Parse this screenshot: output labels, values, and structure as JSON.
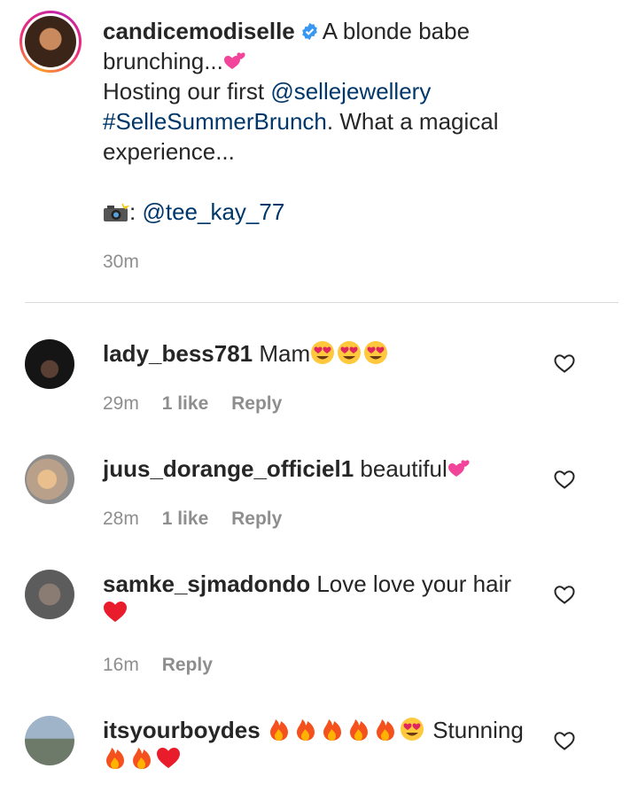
{
  "caption": {
    "username": "candicemodiselle",
    "line1": "A blonde babe",
    "line2": "brunching...",
    "hosting_prefix": "Hosting our first",
    "mention": "@sellejewellery",
    "hashtag": "#SelleSummerBrunch",
    "after_hashtag": ". What a magical",
    "line5": "experience...",
    "photo_credit_sep": ":",
    "photo_credit": "@tee_kay_77",
    "time": "30m"
  },
  "comments": [
    {
      "username": "lady_bess781",
      "text": "Mam",
      "emojis": [
        "heart-eyes-emoji",
        "heart-eyes-emoji",
        "heart-eyes-emoji"
      ],
      "time": "29m",
      "likes": "1 like",
      "reply": "Reply"
    },
    {
      "username": "juus_dorange_officiel1",
      "text": "beautiful",
      "emojis": [
        "two-hearts-emoji"
      ],
      "time": "28m",
      "likes": "1 like",
      "reply": "Reply"
    },
    {
      "username": "samke_sjmadondo",
      "text": "Love love your hair",
      "emojis": [
        "red-heart-emoji"
      ],
      "time": "16m",
      "likes": "",
      "reply": "Reply"
    },
    {
      "username": "itsyourboydes",
      "text": "Stunning",
      "emojis": [
        "fire-emoji",
        "fire-emoji",
        "fire-emoji",
        "fire-emoji",
        "fire-emoji",
        "heart-eyes-emoji",
        "fire-emoji",
        "fire-emoji",
        "red-heart-emoji"
      ]
    }
  ],
  "colors": {
    "link": "#00376b",
    "meta": "#8e8e8e",
    "text": "#262626",
    "verified": "#3897f0"
  },
  "icons": {
    "like": "heart-outline-icon",
    "verified": "verified-badge-icon",
    "camera": "camera-flash-emoji"
  }
}
